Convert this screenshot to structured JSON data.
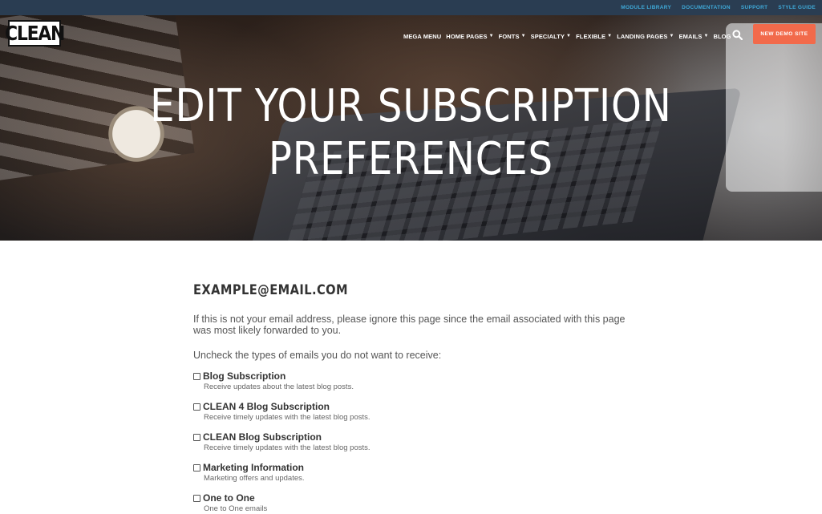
{
  "utility_nav": {
    "items": [
      "MODULE LIBRARY",
      "DOCUMENTATION",
      "SUPPORT",
      "STYLE GUIDE"
    ]
  },
  "logo": {
    "text": "CLEAN"
  },
  "main_nav": {
    "items": [
      {
        "label": "MEGA MENU",
        "has_dropdown": false
      },
      {
        "label": "HOME PAGES",
        "has_dropdown": true
      },
      {
        "label": "FONTS",
        "has_dropdown": true
      },
      {
        "label": "SPECIALTY",
        "has_dropdown": true
      },
      {
        "label": "FLEXIBLE",
        "has_dropdown": true
      },
      {
        "label": "LANDING PAGES",
        "has_dropdown": true
      },
      {
        "label": "EMAILS",
        "has_dropdown": true
      },
      {
        "label": "BLOG",
        "has_dropdown": false
      }
    ],
    "search_icon": "search-icon",
    "cta_label": "NEW DEMO SITE"
  },
  "hero": {
    "title_line1": "EDIT YOUR SUBSCRIPTION",
    "title_line2": "PREFERENCES"
  },
  "content": {
    "email": "EXAMPLE@EMAIL.COM",
    "notice": "If this is not your email address, please ignore this page since the email associated with this page was most likely forwarded to you.",
    "instruction": "Uncheck the types of emails you do not want to receive:",
    "preferences": [
      {
        "name": "Blog Subscription",
        "description": "Receive updates about the latest blog posts.",
        "checked": false
      },
      {
        "name": "CLEAN 4 Blog Subscription",
        "description": "Receive timely updates with the latest blog posts.",
        "checked": false
      },
      {
        "name": "CLEAN Blog Subscription",
        "description": "Receive timely updates with the latest blog posts.",
        "checked": false
      },
      {
        "name": "Marketing Information",
        "description": "Marketing offers and updates.",
        "checked": false
      },
      {
        "name": "One to One",
        "description": "One to One emails",
        "checked": false
      }
    ]
  },
  "colors": {
    "utility_bar": "#2a3d52",
    "utility_link": "#3fa9d8",
    "cta": "#f26a4b"
  }
}
